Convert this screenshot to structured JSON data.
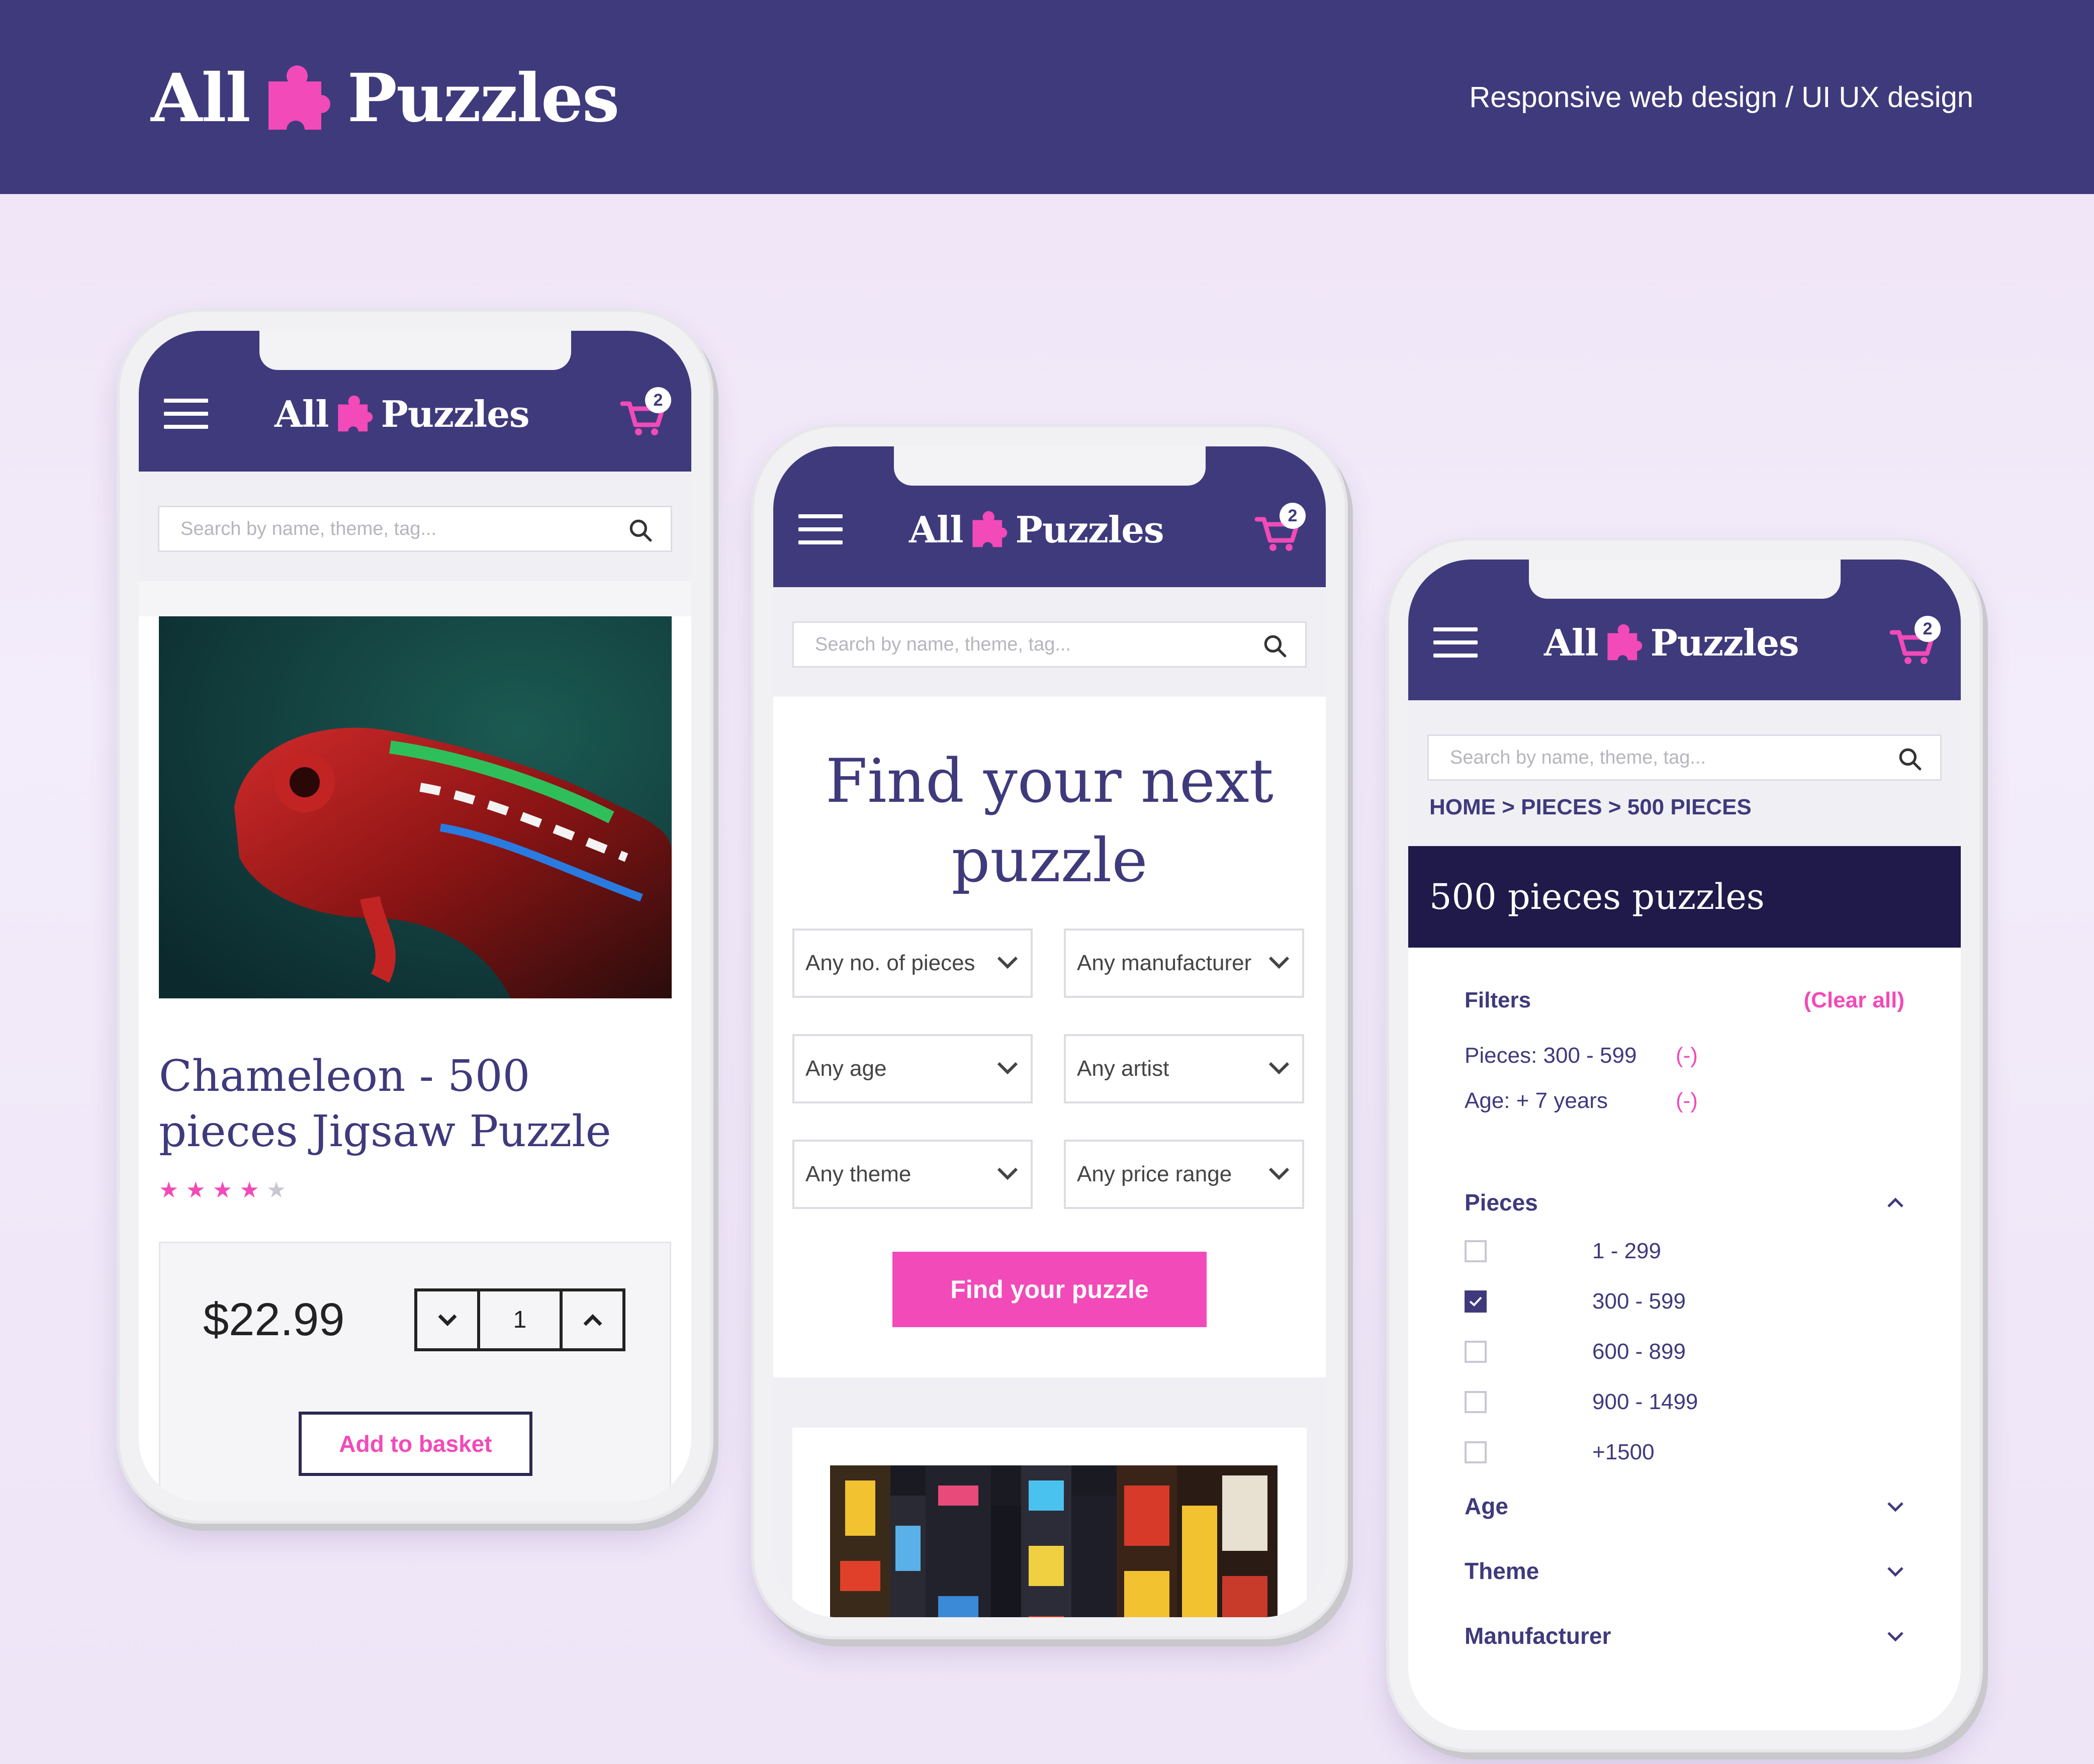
{
  "header": {
    "brand_left": "All",
    "brand_right": "Puzzles",
    "tagline": "Responsive web design / UI UX design"
  },
  "colors": {
    "primary": "#3f3a7c",
    "accent": "#f24ab8",
    "dark": "#1f1a49"
  },
  "mobile_header": {
    "logo_left": "All",
    "logo_right": "Puzzles",
    "cart_count": "2",
    "search_placeholder": "Search by name, theme, tag..."
  },
  "product_page": {
    "title": "Chameleon - 500 pieces Jigsaw Puzzle",
    "rating": 4,
    "rating_max": 5,
    "price": "$22.99",
    "quantity": "1",
    "add_label": "Add to basket"
  },
  "finder_page": {
    "heading": "Find your next puzzle",
    "dropdowns": [
      "Any no. of pieces",
      "Any manufacturer",
      "Any age",
      "Any artist",
      "Any theme",
      "Any price range"
    ],
    "button": "Find your puzzle"
  },
  "listing_page": {
    "breadcrumb": [
      "HOME",
      "PIECES",
      "500 PIECES"
    ],
    "breadcrumb_sep": ">",
    "category_title": "500 pieces puzzles",
    "filters_label": "Filters",
    "clear_all": "(Clear all)",
    "active_filters": [
      {
        "label": "Pieces: 300 - 599",
        "remove": "(-)"
      },
      {
        "label": "Age: + 7 years",
        "remove": "(-)"
      }
    ],
    "pieces_label": "Pieces",
    "piece_options": [
      {
        "label": "1 - 299",
        "checked": false
      },
      {
        "label": "300 - 599",
        "checked": true
      },
      {
        "label": "600 - 899",
        "checked": false
      },
      {
        "label": "900 - 1499",
        "checked": false
      },
      {
        "label": "+1500",
        "checked": false
      }
    ],
    "collapsed_sections": [
      "Age",
      "Theme",
      "Manufacturer"
    ]
  }
}
